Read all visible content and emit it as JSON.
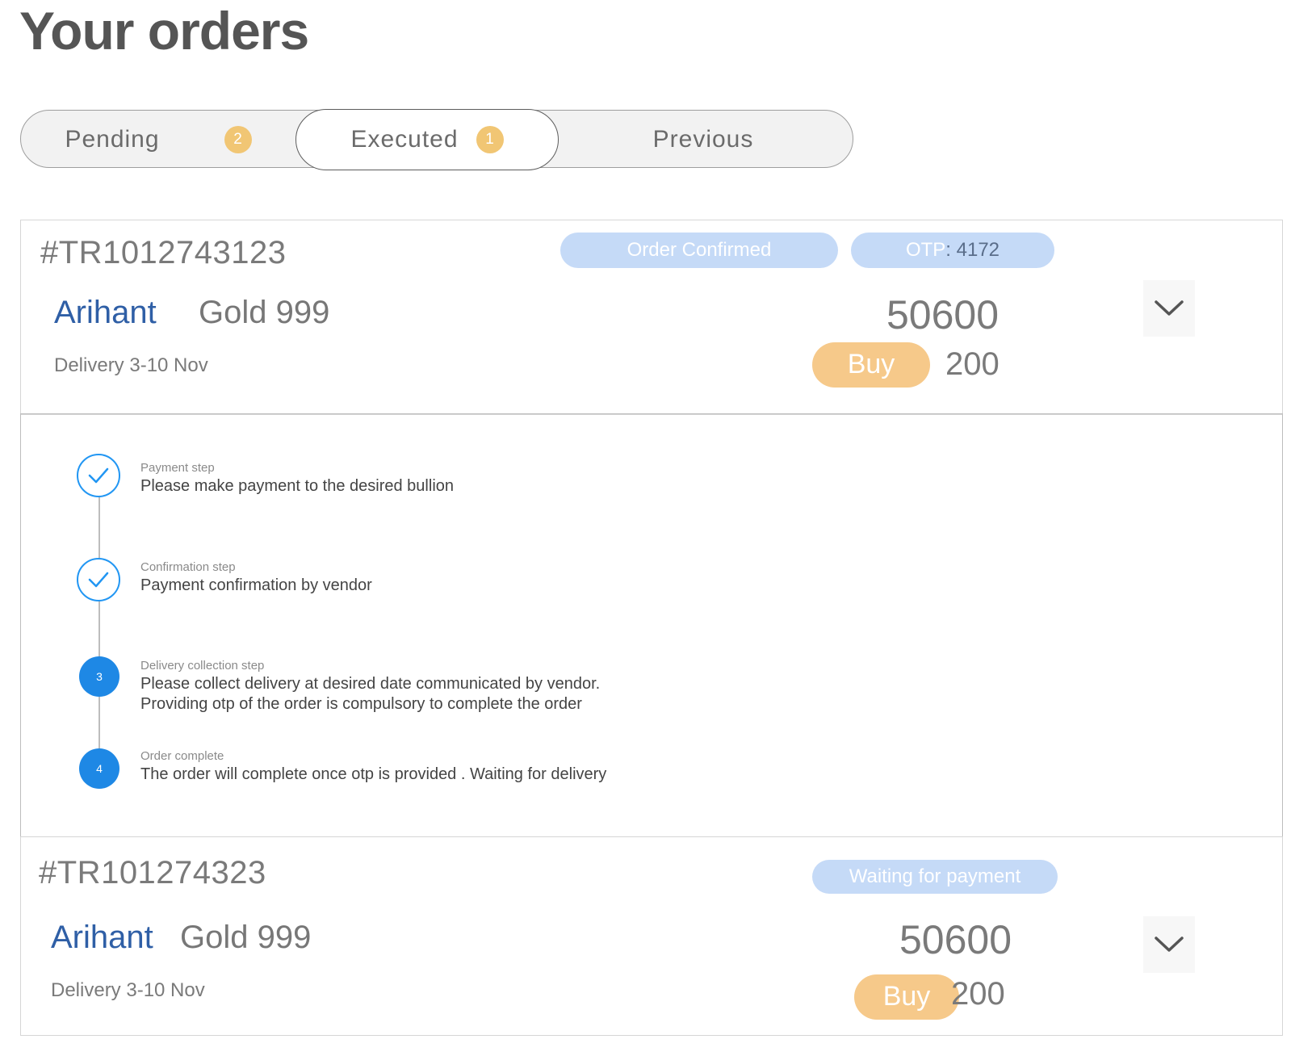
{
  "page": {
    "title": "Your orders"
  },
  "tabs": [
    {
      "label": "Pending",
      "badge": "2"
    },
    {
      "label": "Executed",
      "badge": "1"
    },
    {
      "label": "Previous"
    }
  ],
  "orders": [
    {
      "id": "#TR1012743123",
      "status": "Order Confirmed",
      "otp_label": "OTP",
      "otp_value": ": 4172",
      "brand": "Arihant",
      "product": "Gold 999",
      "delivery": "Delivery 3-10 Nov",
      "price": "50600",
      "action": "Buy",
      "quantity": "200"
    },
    {
      "id": "#TR101274323",
      "status": "Waiting for payment",
      "brand": "Arihant",
      "product": "Gold 999",
      "delivery": "Delivery 3-10 Nov",
      "price": "50600",
      "action": "Buy",
      "quantity": "200"
    }
  ],
  "steps": [
    {
      "label": "Payment step",
      "text": "Please make payment to the desired bullion",
      "state": "done"
    },
    {
      "label": "Confirmation step",
      "text": "Payment confirmation by vendor",
      "state": "done"
    },
    {
      "label": "Delivery collection step",
      "number": "3",
      "text_line1": "Please collect delivery at desired date communicated by vendor.",
      "text_line2": "Providing otp of the order is compulsory to complete the order",
      "state": "pending"
    },
    {
      "label": "Order complete",
      "number": "4",
      "text": "The order will complete once otp is provided . Waiting for delivery",
      "state": "pending"
    }
  ],
  "colors": {
    "brand_blue": "#2f5fa6",
    "status_pill": "#c5daf7",
    "badge": "#f1c674",
    "buy": "#f6c98a",
    "step_blue": "#1e88e5"
  },
  "icons": {
    "chevron": "chevron-down-icon",
    "check": "check-icon"
  }
}
